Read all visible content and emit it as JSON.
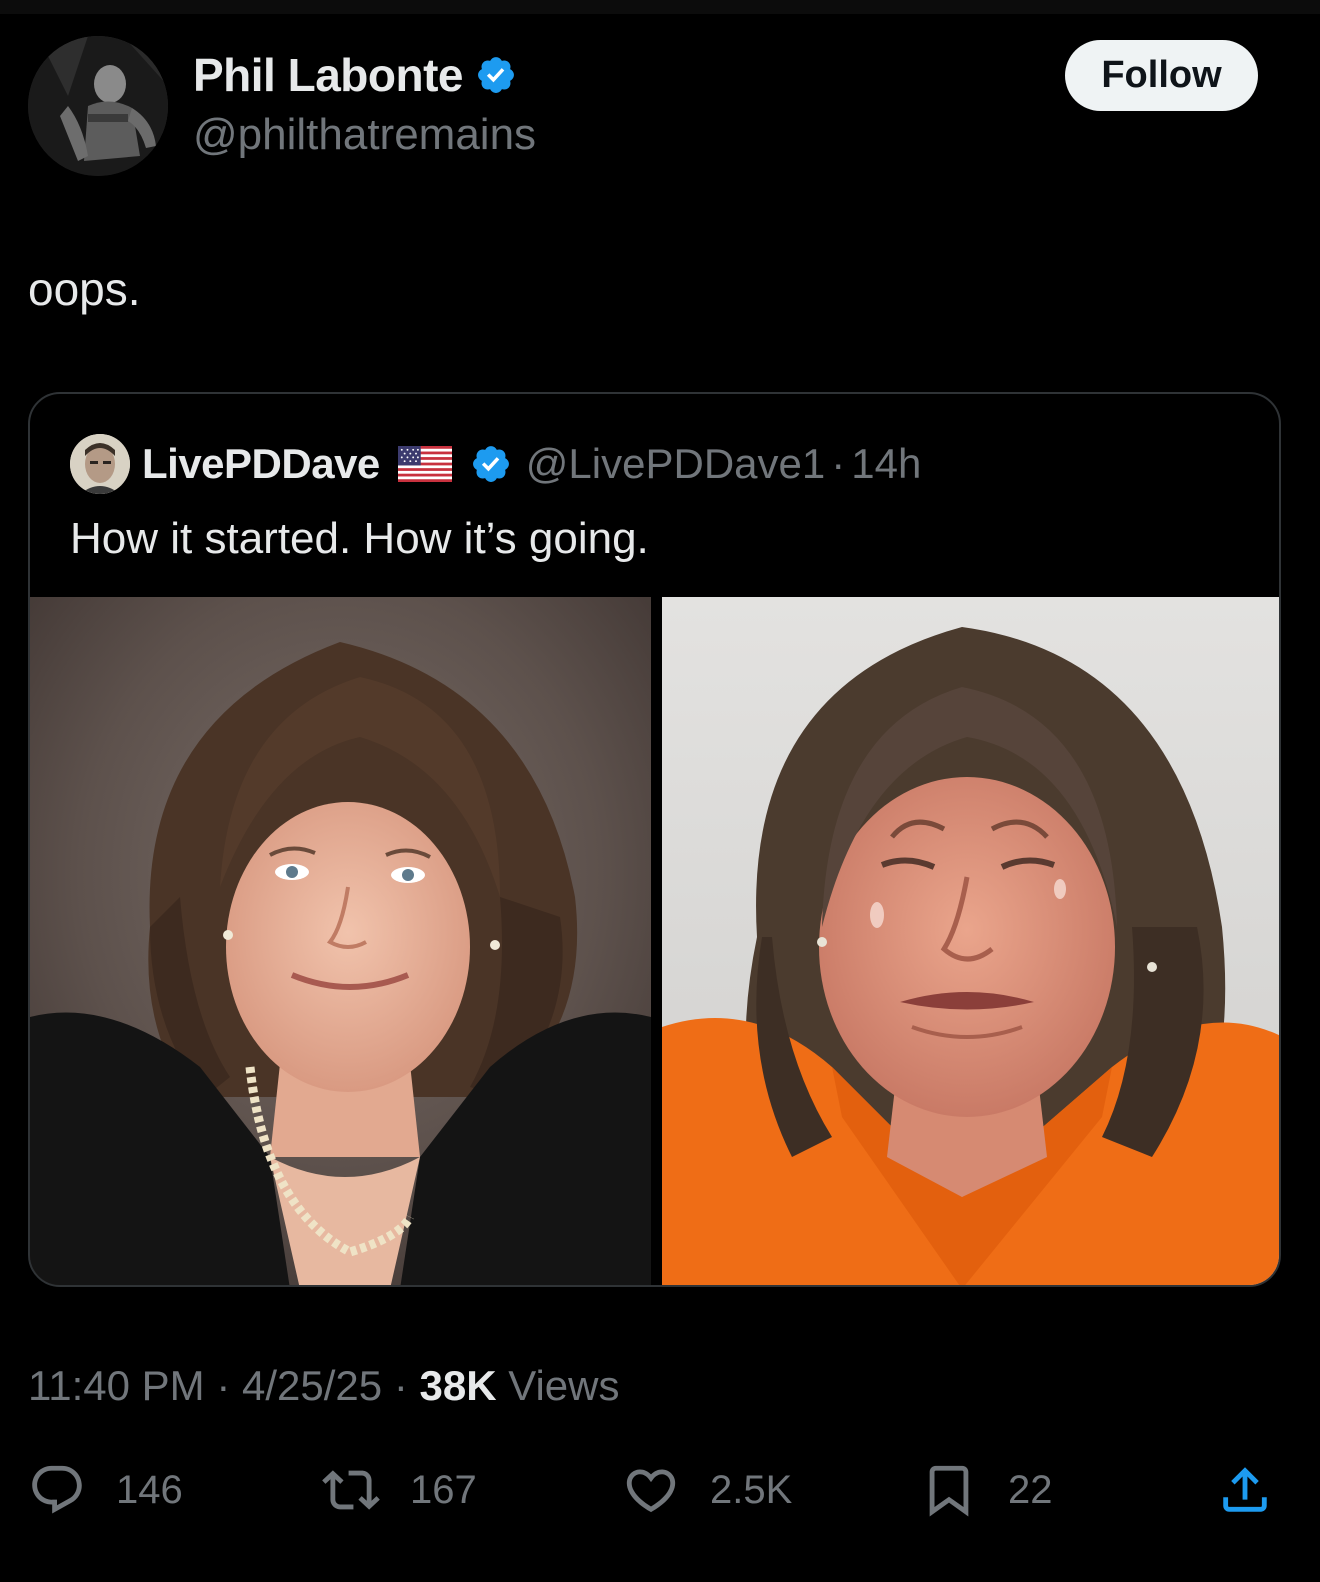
{
  "author": {
    "display_name": "Phil Labonte",
    "handle": "@philthatremains",
    "verified": true,
    "follow_label": "Follow"
  },
  "tweet": {
    "text": "oops."
  },
  "quote": {
    "display_name": "LivePDDave",
    "flag": "us-flag-icon",
    "verified": true,
    "handle": "@LivePDDave1",
    "separator": "·",
    "time": "14h",
    "text": "How it started. How it’s going.",
    "photos": [
      "left-photo",
      "right-photo"
    ]
  },
  "meta": {
    "time": "11:40 PM",
    "sep1": "·",
    "date": "4/25/25",
    "sep2": "·",
    "views_count": "38K",
    "views_label": "Views"
  },
  "actions": {
    "replies": "146",
    "reposts": "167",
    "likes": "2.5K",
    "bookmarks": "22"
  },
  "colors": {
    "background": "#000000",
    "text": "#e7e9ea",
    "muted": "#71767b",
    "verified_blue": "#1d9bf0",
    "border": "#2f3336",
    "follow_bg": "#eff3f4"
  }
}
